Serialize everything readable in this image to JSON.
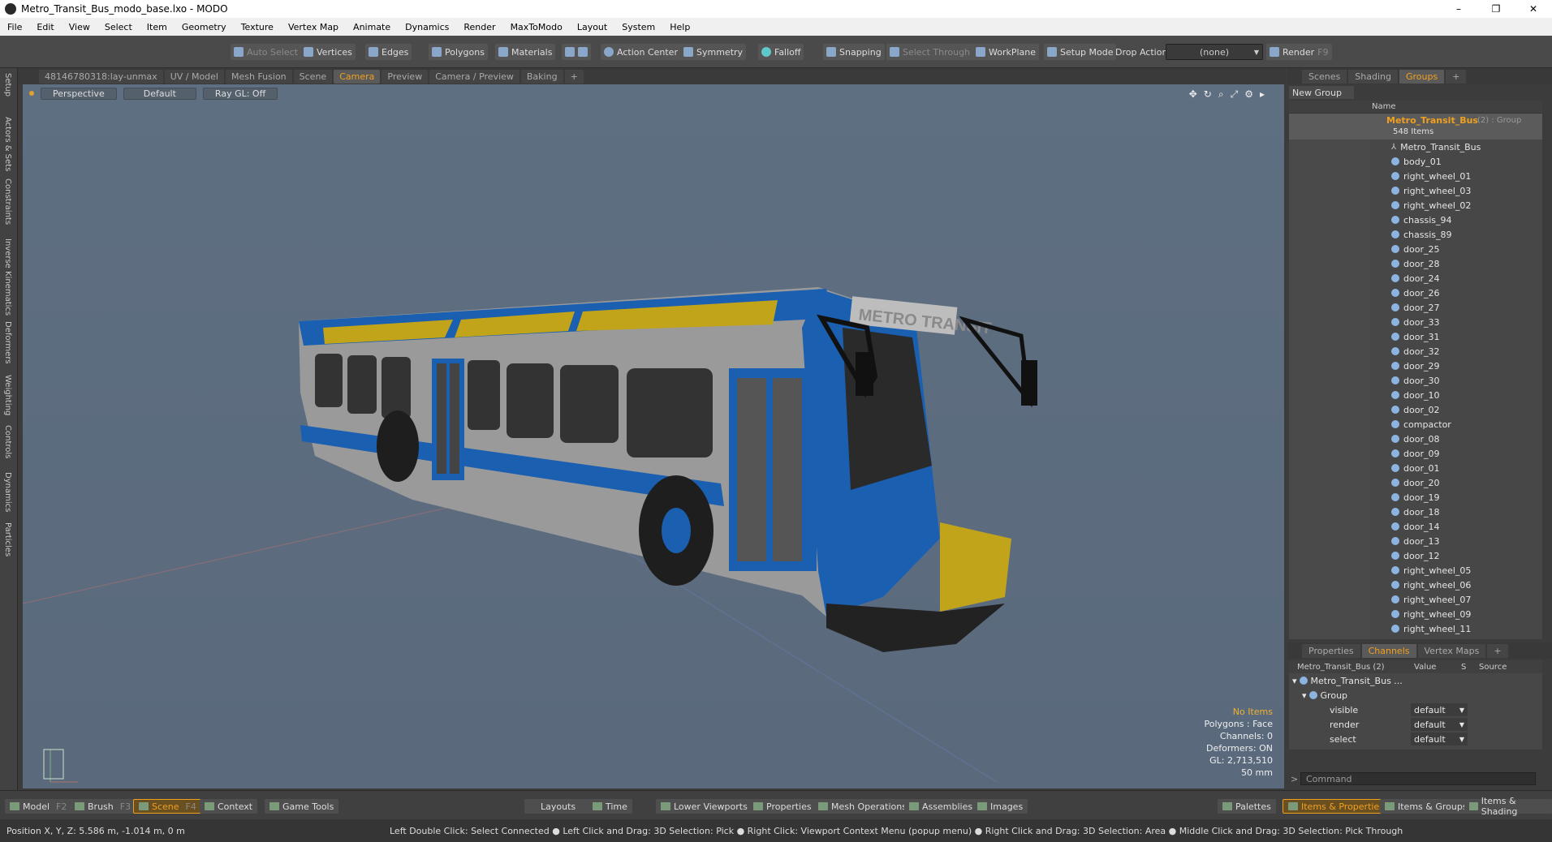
{
  "window": {
    "title": "Metro_Transit_Bus_modo_base.lxo - MODO",
    "minimize": "–",
    "maximize": "❐",
    "close": "✕"
  },
  "menu": [
    "File",
    "Edit",
    "View",
    "Select",
    "Item",
    "Geometry",
    "Texture",
    "Vertex Map",
    "Animate",
    "Dynamics",
    "Render",
    "MaxToModo",
    "Layout",
    "System",
    "Help"
  ],
  "toolbar": {
    "auto_select": "Auto Select",
    "vertices": "Vertices",
    "edges": "Edges",
    "polygons": "Polygons",
    "materials": "Materials",
    "action_center": "Action Center",
    "symmetry": "Symmetry",
    "falloff": "Falloff",
    "snapping": "Snapping",
    "select_through": "Select Through",
    "workplane": "WorkPlane",
    "setup_mode": "Setup Mode",
    "drop_action": "Drop Action",
    "drop_value": "(none)",
    "render": "Render",
    "render_key": "F9"
  },
  "left_tabs": [
    "Setup",
    "Actors & Sets",
    "Constraints",
    "Inverse Kinematics",
    "Deformers",
    "Weighting",
    "Controls",
    "Dynamics",
    "Particles"
  ],
  "viewport_tabs": [
    "48146780318:lay-unmax",
    "UV / Model",
    "Mesh Fusion",
    "Scene",
    "Camera",
    "Preview",
    "Camera / Preview",
    "Baking",
    "+"
  ],
  "viewport_active_tab": "Camera",
  "viewport": {
    "view_mode": "Perspective",
    "shading": "Default",
    "raygl": "Ray GL: Off",
    "info": {
      "items": "No Items",
      "polygons": "Polygons : Face",
      "channels": "Channels: 0",
      "deformers": "Deformers: ON",
      "gl": "GL: 2,713,510",
      "focal": "50 mm"
    },
    "bus_sign": "METRO TRANSIT"
  },
  "right_tabs": [
    "Scenes",
    "Shading",
    "Groups",
    "+"
  ],
  "right_active_tab": "Groups",
  "new_group": "New Group",
  "tree_name_header": "Name",
  "group": {
    "name": "Metro_Transit_Bus",
    "suffix": "(2) : Group",
    "count": "548 Items"
  },
  "tree_items": [
    "Metro_Transit_Bus",
    "body_01",
    "right_wheel_01",
    "right_wheel_03",
    "right_wheel_02",
    "chassis_94",
    "chassis_89",
    "door_25",
    "door_28",
    "door_24",
    "door_26",
    "door_27",
    "door_33",
    "door_31",
    "door_32",
    "door_29",
    "door_30",
    "door_10",
    "door_02",
    "compactor",
    "door_08",
    "door_09",
    "door_01",
    "door_20",
    "door_19",
    "door_18",
    "door_14",
    "door_13",
    "door_12",
    "right_wheel_05",
    "right_wheel_06",
    "right_wheel_07",
    "right_wheel_09",
    "right_wheel_11"
  ],
  "bottom_tabs": [
    "Properties",
    "Channels",
    "Vertex Maps",
    "+"
  ],
  "bottom_active_tab": "Channels",
  "channels": {
    "headers": [
      "Metro_Transit_Bus (2)",
      "Value",
      "S",
      "Source"
    ],
    "root": "Metro_Transit_Bus ...",
    "group": "Group",
    "rows": [
      {
        "name": "visible",
        "value": "default"
      },
      {
        "name": "render",
        "value": "default"
      },
      {
        "name": "select",
        "value": "default"
      }
    ]
  },
  "command_placeholder": "Command",
  "bottombar": {
    "model": "Model",
    "model_key": "F2",
    "brush": "Brush",
    "brush_key": "F3",
    "scene": "Scene",
    "scene_key": "F4",
    "context": "Context",
    "game_tools": "Game Tools",
    "layouts": "Layouts",
    "time": "Time",
    "lower_viewports": "Lower Viewports",
    "properties": "Properties",
    "mesh_operations": "Mesh Operations",
    "assemblies": "Assemblies",
    "images": "Images",
    "palettes": "Palettes",
    "items_properties": "Items & Properties",
    "items_groups": "Items & Groups",
    "items_shading": "Items & Shading"
  },
  "status": {
    "position": "Position X, Y, Z:   5.586 m, -1.014 m, 0 m",
    "hints": "Left Double Click: Select Connected ● Left Click and Drag: 3D Selection: Pick ● Right Click: Viewport Context Menu (popup menu) ● Right Click and Drag: 3D Selection: Area ● Middle Click and Drag: 3D Selection: Pick Through"
  }
}
